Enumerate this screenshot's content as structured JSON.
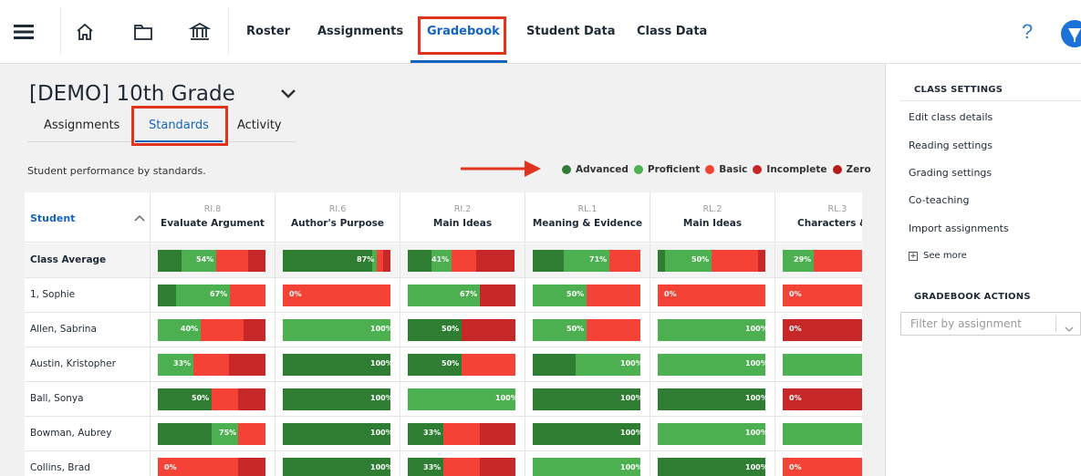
{
  "nav": {
    "links": [
      "Roster",
      "Assignments",
      "Gradebook",
      "Student Data",
      "Class Data"
    ],
    "help": "?",
    "icons": [
      "menu-icon",
      "home-icon",
      "folder-icon",
      "library-icon"
    ]
  },
  "class": {
    "title": "[DEMO] 10th Grade",
    "tabs": [
      "Assignments",
      "Standards",
      "Activity"
    ],
    "active_tab": "Standards"
  },
  "legend": {
    "description": "Student performance by standards.",
    "items": [
      {
        "label": "Advanced",
        "color": "#2e7d32"
      },
      {
        "label": "Proficient",
        "color": "#4caf50"
      },
      {
        "label": "Basic",
        "color": "#f44336"
      },
      {
        "label": "Incomplete",
        "color": "#c62828"
      },
      {
        "label": "Zero",
        "color": "#b71c1c"
      }
    ]
  },
  "table": {
    "student_header": "Student",
    "columns": [
      {
        "code": "RI.8",
        "name": "Evaluate Argument"
      },
      {
        "code": "RI.6",
        "name": "Author's Purpose"
      },
      {
        "code": "RI.2",
        "name": "Main Ideas"
      },
      {
        "code": "RL.1",
        "name": "Meaning & Evidence"
      },
      {
        "code": "RL.2",
        "name": "Main Ideas"
      },
      {
        "code": "RL.3",
        "name": "Characters & F"
      }
    ],
    "rows": [
      {
        "name": "Class Average",
        "cells": [
          {
            "label": "54%",
            "segs": [
              [
                0.22,
                "adv"
              ],
              [
                0.32,
                "pro"
              ],
              [
                0.3,
                "bas"
              ],
              [
                0.16,
                "inc"
              ]
            ]
          },
          {
            "label": "87%",
            "segs": [
              [
                0.83,
                "adv"
              ],
              [
                0.04,
                "pro"
              ],
              [
                0.06,
                "bas"
              ],
              [
                0.07,
                "inc"
              ]
            ]
          },
          {
            "label": "41%",
            "segs": [
              [
                0.22,
                "adv"
              ],
              [
                0.19,
                "pro"
              ],
              [
                0.23,
                "bas"
              ],
              [
                0.36,
                "inc"
              ]
            ]
          },
          {
            "label": "71%",
            "segs": [
              [
                0.29,
                "adv"
              ],
              [
                0.42,
                "pro"
              ],
              [
                0.29,
                "bas"
              ]
            ]
          },
          {
            "label": "50%",
            "segs": [
              [
                0.07,
                "adv"
              ],
              [
                0.43,
                "pro"
              ],
              [
                0.43,
                "bas"
              ],
              [
                0.07,
                "inc"
              ]
            ]
          },
          {
            "label": "29%",
            "segs": [
              [
                0.29,
                "pro"
              ],
              [
                0.71,
                "bas"
              ]
            ]
          }
        ]
      },
      {
        "name": "1, Sophie",
        "cells": [
          {
            "label": "67%",
            "segs": [
              [
                0.17,
                "adv"
              ],
              [
                0.5,
                "pro"
              ],
              [
                0.33,
                "bas"
              ]
            ]
          },
          {
            "label": "0%",
            "segs": [
              [
                1.0,
                "bas"
              ]
            ]
          },
          {
            "label": "67%",
            "segs": [
              [
                0.67,
                "pro"
              ],
              [
                0.33,
                "inc"
              ]
            ]
          },
          {
            "label": "50%",
            "segs": [
              [
                0.5,
                "pro"
              ],
              [
                0.5,
                "bas"
              ]
            ]
          },
          {
            "label": "0%",
            "segs": [
              [
                1.0,
                "bas"
              ]
            ]
          },
          {
            "label": "0%",
            "segs": [
              [
                1.0,
                "bas"
              ]
            ]
          }
        ]
      },
      {
        "name": "Allen, Sabrina",
        "cells": [
          {
            "label": "40%",
            "segs": [
              [
                0.4,
                "pro"
              ],
              [
                0.4,
                "bas"
              ],
              [
                0.2,
                "inc"
              ]
            ]
          },
          {
            "label": "100%",
            "segs": [
              [
                1.0,
                "pro"
              ]
            ]
          },
          {
            "label": "50%",
            "segs": [
              [
                0.5,
                "adv"
              ],
              [
                0.5,
                "inc"
              ]
            ]
          },
          {
            "label": "50%",
            "segs": [
              [
                0.5,
                "pro"
              ],
              [
                0.5,
                "bas"
              ]
            ]
          },
          {
            "label": "100%",
            "segs": [
              [
                1.0,
                "pro"
              ]
            ]
          },
          {
            "label": "0%",
            "segs": [
              [
                1.0,
                "inc"
              ]
            ]
          }
        ]
      },
      {
        "name": "Austin, Kristopher",
        "cells": [
          {
            "label": "33%",
            "segs": [
              [
                0.33,
                "pro"
              ],
              [
                0.33,
                "bas"
              ],
              [
                0.34,
                "inc"
              ]
            ]
          },
          {
            "label": "100%",
            "segs": [
              [
                1.0,
                "adv"
              ]
            ]
          },
          {
            "label": "50%",
            "segs": [
              [
                0.5,
                "adv"
              ],
              [
                0.5,
                "bas"
              ]
            ]
          },
          {
            "label": "100%",
            "segs": [
              [
                0.4,
                "adv"
              ],
              [
                0.6,
                "pro"
              ]
            ]
          },
          {
            "label": "100%",
            "segs": [
              [
                1.0,
                "pro"
              ]
            ]
          },
          {
            "label": "",
            "segs": [
              [
                1.0,
                "pro"
              ]
            ]
          }
        ]
      },
      {
        "name": "Ball, Sonya",
        "cells": [
          {
            "label": "50%",
            "segs": [
              [
                0.5,
                "adv"
              ],
              [
                0.25,
                "bas"
              ],
              [
                0.25,
                "inc"
              ]
            ]
          },
          {
            "label": "100%",
            "segs": [
              [
                1.0,
                "adv"
              ]
            ]
          },
          {
            "label": "100%",
            "segs": [
              [
                0.67,
                "pro"
              ],
              [
                0.33,
                "pro"
              ]
            ]
          },
          {
            "label": "100%",
            "segs": [
              [
                1.0,
                "adv"
              ]
            ]
          },
          {
            "label": "100%",
            "segs": [
              [
                1.0,
                "adv"
              ]
            ]
          },
          {
            "label": "0%",
            "segs": [
              [
                1.0,
                "inc"
              ]
            ]
          }
        ]
      },
      {
        "name": "Bowman, Aubrey",
        "cells": [
          {
            "label": "75%",
            "segs": [
              [
                0.5,
                "adv"
              ],
              [
                0.25,
                "pro"
              ],
              [
                0.25,
                "bas"
              ]
            ]
          },
          {
            "label": "100%",
            "segs": [
              [
                1.0,
                "adv"
              ]
            ]
          },
          {
            "label": "33%",
            "segs": [
              [
                0.33,
                "adv"
              ],
              [
                0.34,
                "bas"
              ],
              [
                0.33,
                "inc"
              ]
            ]
          },
          {
            "label": "100%",
            "segs": [
              [
                1.0,
                "adv"
              ]
            ]
          },
          {
            "label": "100%",
            "segs": [
              [
                1.0,
                "pro"
              ]
            ]
          },
          {
            "label": "",
            "segs": [
              [
                1.0,
                "pro"
              ]
            ]
          }
        ]
      },
      {
        "name": "Collins, Brad",
        "cells": [
          {
            "label": "0%",
            "segs": [
              [
                0.75,
                "bas"
              ],
              [
                0.25,
                "inc"
              ]
            ]
          },
          {
            "label": "100%",
            "segs": [
              [
                1.0,
                "adv"
              ]
            ]
          },
          {
            "label": "33%",
            "segs": [
              [
                0.33,
                "adv"
              ],
              [
                0.34,
                "bas"
              ],
              [
                0.33,
                "inc"
              ]
            ]
          },
          {
            "label": "100%",
            "segs": [
              [
                1.0,
                "pro"
              ]
            ]
          },
          {
            "label": "100%",
            "segs": [
              [
                1.0,
                "adv"
              ]
            ]
          },
          {
            "label": "0%",
            "segs": [
              [
                1.0,
                "bas"
              ]
            ]
          }
        ]
      }
    ]
  },
  "sidebar": {
    "settings_title": "CLASS SETTINGS",
    "links": [
      "Edit class details",
      "Reading settings",
      "Grading settings",
      "Co-teaching",
      "Import assignments"
    ],
    "see_more": "See more",
    "actions_title": "GRADEBOOK ACTIONS",
    "filter_placeholder": "Filter by assignment"
  },
  "colors": {
    "adv": "#2e7d32",
    "pro": "#4caf50",
    "bas": "#f44336",
    "inc": "#c62828",
    "accent": "#1565c0",
    "highlight": "#e0341f"
  }
}
